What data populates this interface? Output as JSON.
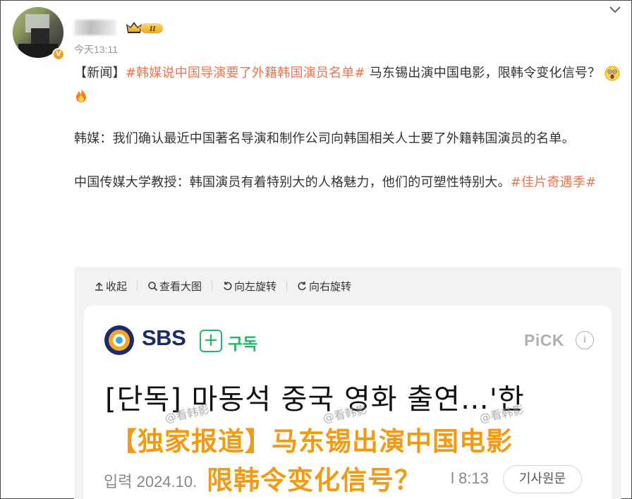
{
  "post": {
    "timestamp": "今天13:11",
    "verified_badge": "V",
    "vip_level": "II",
    "paragraph1": {
      "prefix": "【新闻】",
      "hashtag": "#韩媒说中国导演要了外籍韩国演员名单#",
      "text": " 马东锡出演中国电影，限韩令变化信号？",
      "emojis": [
        "shocked-face",
        "fire"
      ]
    },
    "paragraph2": "韩媒：我们确认最近中国著名导演和制作公司向韩国相关人士要了外籍韩国演员的名单。",
    "paragraph3": {
      "text": "中国传媒大学教授：韩国演员有着特别大的人格魅力，他们的可塑性特别大。",
      "hashtag": "#佳片奇遇季#"
    }
  },
  "toolbar": {
    "collapse": "收起",
    "view_large": "查看大图",
    "rotate_left": "向左旋转",
    "rotate_right": "向右旋转"
  },
  "article_image": {
    "logo_text": "SBS",
    "subscribe": "구독",
    "pick": "PiCK",
    "info": "i",
    "headline": "[단독] 마동석 중국 영화 출연…'한",
    "watermark": "@看韩影",
    "overlay_line1": "【独家报道】马东锡出演中国电影",
    "overlay_line2": "限韩令变化信号？",
    "input_date": "입력 2024.10.",
    "input_time": "l 8:13",
    "original_button": "기사원문"
  },
  "colors": {
    "hashtag": "#eb7350",
    "overlay": "#f29a14",
    "sbs_navy": "#1b2a6b",
    "subscribe_green": "#29b36b"
  }
}
